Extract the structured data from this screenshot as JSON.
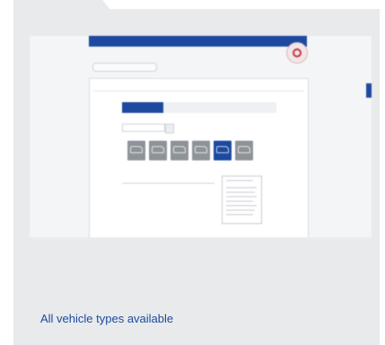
{
  "caption": "All vehicle types available",
  "screenshot": {
    "header": {
      "line1": "",
      "line2": "",
      "right_text": ""
    },
    "breadcrumb": "",
    "panel_title": "",
    "step_tabs": [
      "",
      "",
      "",
      "",
      ""
    ],
    "search_field_value": "",
    "vehicle_types": [
      {
        "name": "vehicle-type-1",
        "selected": false
      },
      {
        "name": "vehicle-type-2",
        "selected": false
      },
      {
        "name": "vehicle-type-3",
        "selected": false
      },
      {
        "name": "vehicle-type-4",
        "selected": false
      },
      {
        "name": "vehicle-type-5",
        "selected": true
      },
      {
        "name": "vehicle-type-6",
        "selected": false
      }
    ],
    "selected_vehicle_label": "",
    "table_headers": [
      "",
      ""
    ],
    "table_row": ""
  },
  "colors": {
    "accent": "#1d4aa0",
    "card_bg": "#e8eaeb",
    "vehicle_tile": "#8e9398"
  }
}
